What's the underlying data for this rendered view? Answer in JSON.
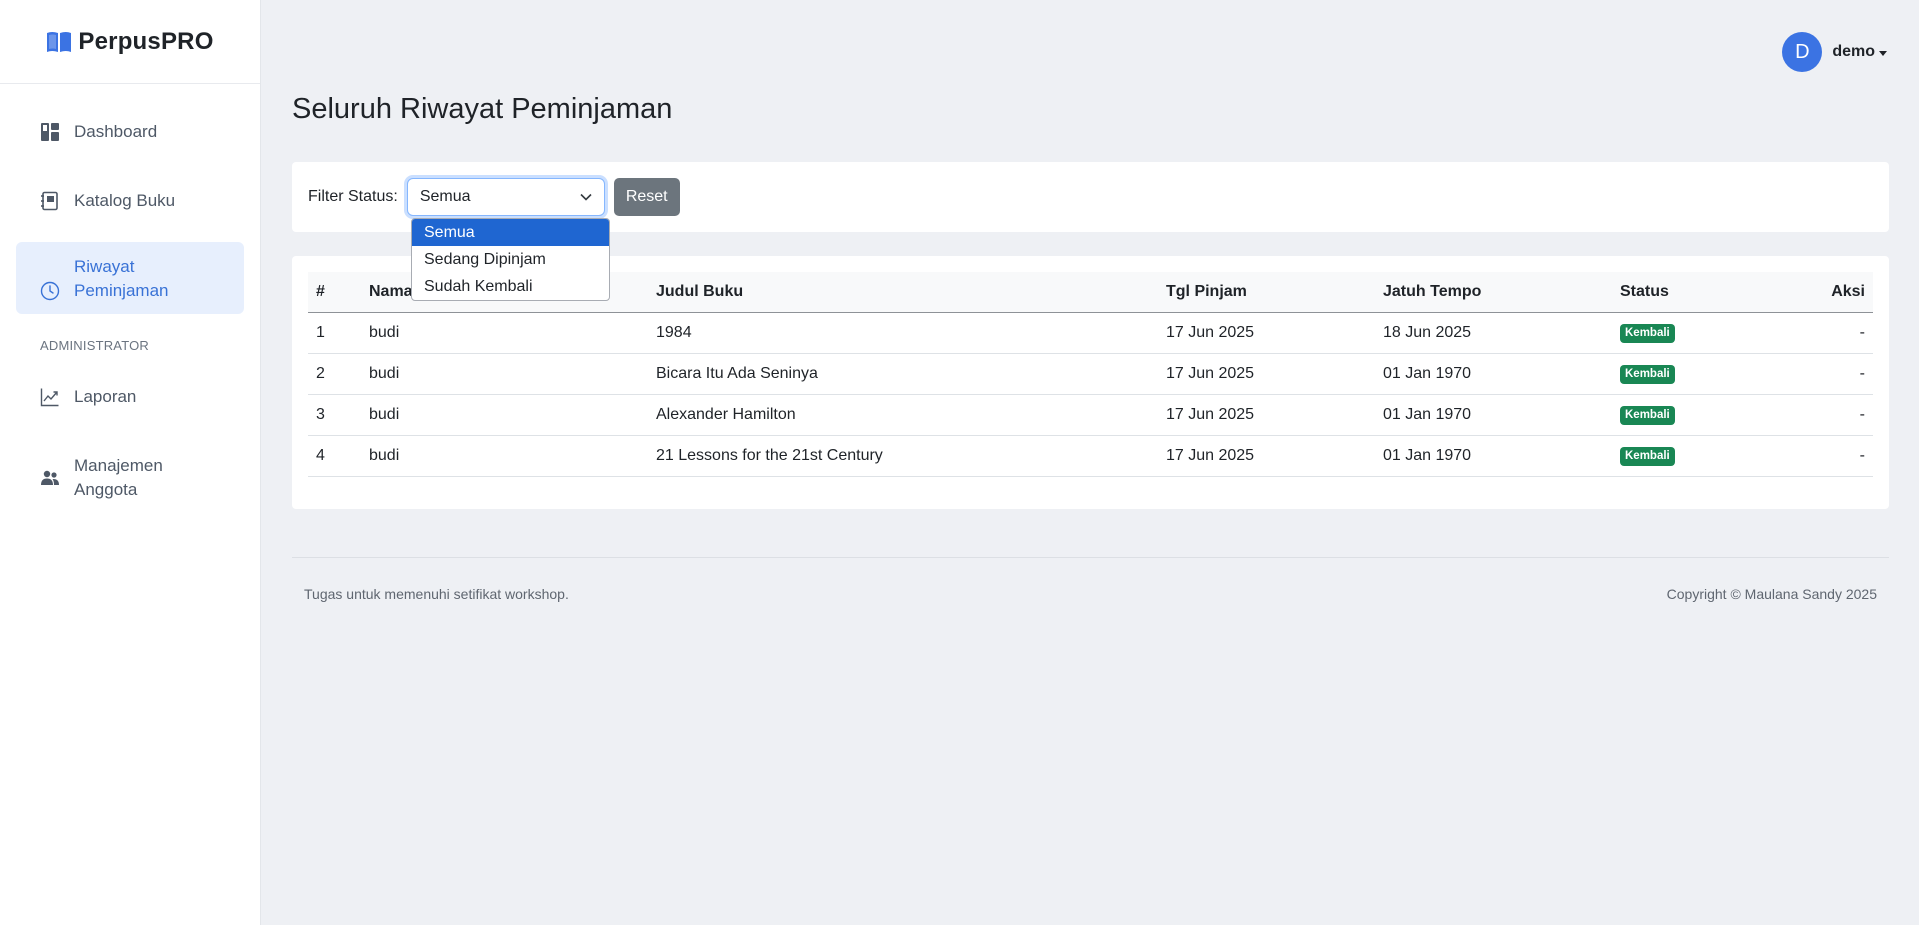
{
  "brand": {
    "name": "PerpusPRO",
    "icon": "book-open-icon",
    "accent": "#3b73e3"
  },
  "sidebar": {
    "items": [
      {
        "label": "Dashboard",
        "icon": "dashboard-icon"
      },
      {
        "label": "Katalog Buku",
        "icon": "book-catalog-icon"
      },
      {
        "label": "Riwayat Peminjaman",
        "icon": "clock-icon",
        "active": true
      }
    ],
    "section_label": "ADMINISTRATOR",
    "admin_items": [
      {
        "label": "Laporan",
        "icon": "chart-line-icon"
      },
      {
        "label": "Manajemen Anggota",
        "icon": "users-icon"
      }
    ]
  },
  "header": {
    "avatar_letter": "D",
    "username": "demo"
  },
  "page": {
    "title": "Seluruh Riwayat Peminjaman"
  },
  "filter": {
    "label": "Filter Status:",
    "selected": "Semua",
    "options": [
      "Semua",
      "Sedang Dipinjam",
      "Sudah Kembali"
    ],
    "reset_label": "Reset"
  },
  "table": {
    "columns": [
      "#",
      "Nama",
      "Judul Buku",
      "Tgl Pinjam",
      "Jatuh Tempo",
      "Status",
      "Aksi"
    ],
    "rows": [
      {
        "no": "1",
        "nama": "budi",
        "judul": "1984",
        "tgl_pinjam": "17 Jun 2025",
        "jatuh_tempo": "18 Jun 2025",
        "status": "Kembali",
        "aksi": "-"
      },
      {
        "no": "2",
        "nama": "budi",
        "judul": "Bicara Itu Ada Seninya",
        "tgl_pinjam": "17 Jun 2025",
        "jatuh_tempo": "01 Jan 1970",
        "status": "Kembali",
        "aksi": "-"
      },
      {
        "no": "3",
        "nama": "budi",
        "judul": "Alexander Hamilton",
        "tgl_pinjam": "17 Jun 2025",
        "jatuh_tempo": "01 Jan 1970",
        "status": "Kembali",
        "aksi": "-"
      },
      {
        "no": "4",
        "nama": "budi",
        "judul": "21 Lessons for the 21st Century",
        "tgl_pinjam": "17 Jun 2025",
        "jatuh_tempo": "01 Jan 1970",
        "status": "Kembali",
        "aksi": "-"
      }
    ],
    "status_color": "#198754"
  },
  "footer": {
    "left": "Tugas untuk memenuhi setifikat workshop.",
    "right": "Copyright © Maulana Sandy 2025"
  }
}
